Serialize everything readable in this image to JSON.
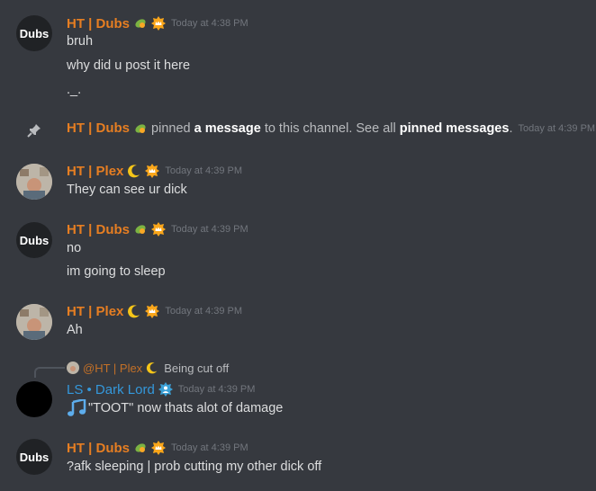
{
  "colors": {
    "background": "#36393f",
    "orange_name": "#e67e22",
    "blue_name": "#3498db",
    "timestamp": "#72767d"
  },
  "messages": [
    {
      "avatar_text": "Dubs",
      "name": "HT | Dubs",
      "time": "Today at 4:38 PM",
      "lines": [
        "bruh",
        "why did u post it here",
        "._."
      ]
    },
    {
      "system": true,
      "name": "HT | Dubs",
      "pre": "pinned",
      "link1": "a message",
      "mid": "to this channel. See all",
      "link2": "pinned messages",
      "dot": ".",
      "time": "Today at 4:39 PM"
    },
    {
      "name": "HT | Plex",
      "time": "Today at 4:39 PM",
      "lines": [
        "They can see ur dick"
      ]
    },
    {
      "avatar_text": "Dubs",
      "name": "HT | Dubs",
      "time": "Today at 4:39 PM",
      "lines": [
        "no",
        "im going to sleep"
      ]
    },
    {
      "name": "HT | Plex",
      "time": "Today at 4:39 PM",
      "lines": [
        "Ah"
      ]
    },
    {
      "reply_name": "@HT | Plex",
      "reply_text": "Being cut off",
      "name": "LS • Dark Lord",
      "time": "Today at 4:39 PM",
      "lines": [
        "\"TOOT\" now thats alot of damage"
      ]
    },
    {
      "avatar_text": "Dubs",
      "name": "HT | Dubs",
      "time": "Today at 4:39 PM",
      "lines": [
        "?afk sleeping | prob cutting my other dick off"
      ]
    }
  ]
}
